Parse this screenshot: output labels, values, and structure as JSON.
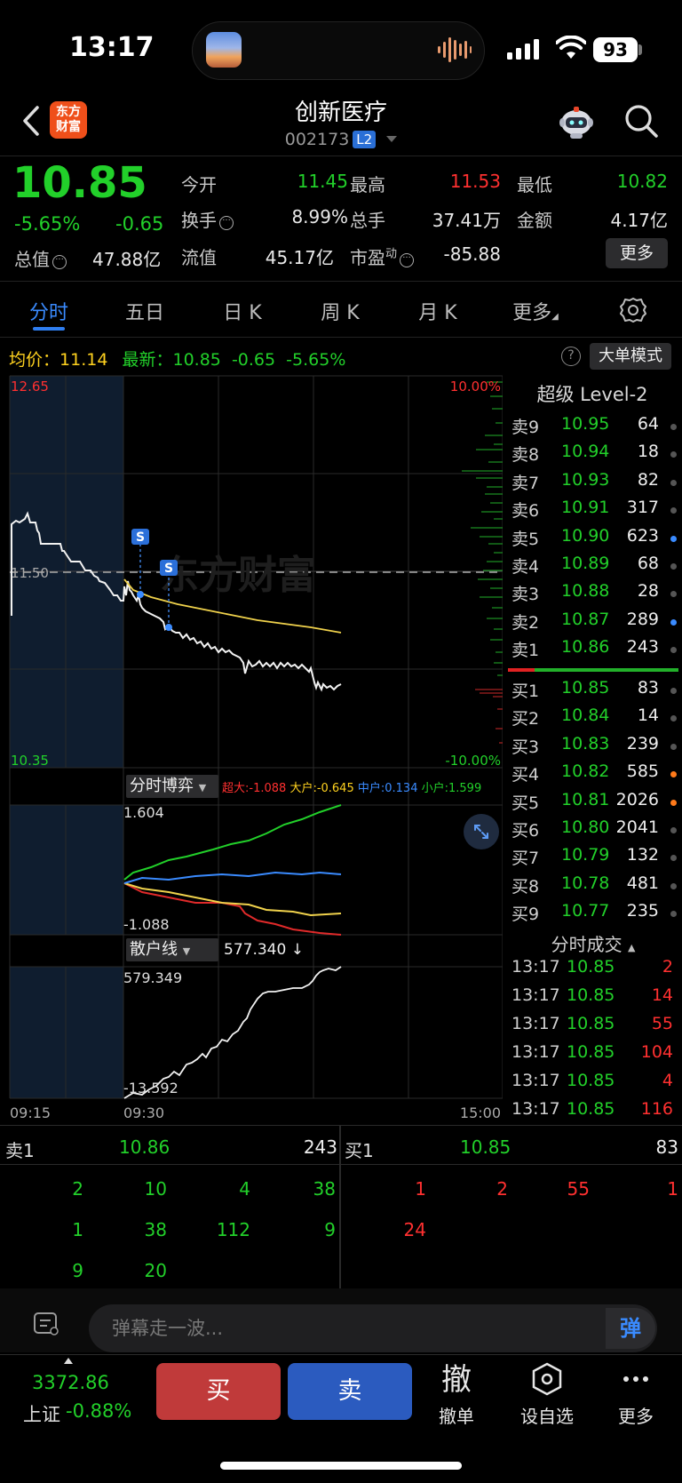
{
  "status": {
    "time": "13:17",
    "battery": "93"
  },
  "header": {
    "logo_line1": "东方",
    "logo_line2": "财富",
    "stock_name": "创新医疗",
    "stock_code": "002173",
    "badge": "L2"
  },
  "quote": {
    "price": "10.85",
    "pct": "-5.65%",
    "change": "-0.65",
    "total_label": "总值",
    "total_value": "47.88亿",
    "stats": [
      {
        "label": "今开",
        "value": "11.45",
        "color": "#22d02a"
      },
      {
        "label": "最高",
        "value": "11.53",
        "color": "#ff3030"
      },
      {
        "label": "最低",
        "value": "10.82",
        "color": "#22d02a"
      },
      {
        "label": "换手",
        "value": "8.99%",
        "color": "#e8e8e8"
      },
      {
        "label": "总手",
        "value": "37.41万",
        "color": "#e8e8e8"
      },
      {
        "label": "金额",
        "value": "4.17亿",
        "color": "#e8e8e8"
      },
      {
        "label": "流值",
        "value": "45.17亿",
        "color": "#e8e8e8"
      },
      {
        "label": "市盈",
        "sup": "动",
        "value": "-85.88",
        "color": "#e8e8e8"
      }
    ],
    "more": "更多"
  },
  "tabs": [
    "分时",
    "五日",
    "日 K",
    "周 K",
    "月 K",
    "更多"
  ],
  "summary": {
    "avg_label": "均价：",
    "avg_value": "11.14",
    "latest_label": "最新：",
    "latest_value": "10.85",
    "latest_change": "-0.65",
    "latest_pct": "-5.65%",
    "help": "?",
    "big_mode": "大单模式"
  },
  "main_chart": {
    "y_top": "12.65",
    "y_bottom": "10.35",
    "y_ref": "11.50",
    "pct_top": "10.00%",
    "pct_bottom": "-10.00%",
    "watermark": "东方财富",
    "marker": "S",
    "times": [
      "09:15",
      "09:30",
      "15:00"
    ]
  },
  "sub1": {
    "label": "分时博弈",
    "top": "1.604",
    "bottom": "-1.088",
    "values": [
      {
        "text": "超大:-1.088",
        "color": "#ff3030"
      },
      {
        "text": "大户:-0.645",
        "color": "#ffd21f"
      },
      {
        "text": "中户:0.134",
        "color": "#3a8bff"
      },
      {
        "text": "小户:1.599",
        "color": "#22d02a"
      }
    ]
  },
  "sub2": {
    "label": "散户线",
    "value": "577.340 ↓",
    "top": "579.349",
    "bottom": "-13.592"
  },
  "orderbook": {
    "title": "超级 Level-2",
    "asks": [
      {
        "label": "卖9",
        "price": "10.95",
        "vol": "64",
        "dot": "#555"
      },
      {
        "label": "卖8",
        "price": "10.94",
        "vol": "18",
        "dot": "#555"
      },
      {
        "label": "卖7",
        "price": "10.93",
        "vol": "82",
        "dot": "#555"
      },
      {
        "label": "卖6",
        "price": "10.91",
        "vol": "317",
        "dot": "#555"
      },
      {
        "label": "卖5",
        "price": "10.90",
        "vol": "623",
        "dot": "#3a8bff"
      },
      {
        "label": "卖4",
        "price": "10.89",
        "vol": "68",
        "dot": "#555"
      },
      {
        "label": "卖3",
        "price": "10.88",
        "vol": "28",
        "dot": "#555"
      },
      {
        "label": "卖2",
        "price": "10.87",
        "vol": "289",
        "dot": "#3a8bff"
      },
      {
        "label": "卖1",
        "price": "10.86",
        "vol": "243",
        "dot": "#555"
      }
    ],
    "bids": [
      {
        "label": "买1",
        "price": "10.85",
        "vol": "83",
        "dot": "#555"
      },
      {
        "label": "买2",
        "price": "10.84",
        "vol": "14",
        "dot": "#555"
      },
      {
        "label": "买3",
        "price": "10.83",
        "vol": "239",
        "dot": "#555"
      },
      {
        "label": "买4",
        "price": "10.82",
        "vol": "585",
        "dot": "#ff7a1a"
      },
      {
        "label": "买5",
        "price": "10.81",
        "vol": "2026",
        "dot": "#ff7a1a"
      },
      {
        "label": "买6",
        "price": "10.80",
        "vol": "2041",
        "dot": "#555"
      },
      {
        "label": "买7",
        "price": "10.79",
        "vol": "132",
        "dot": "#555"
      },
      {
        "label": "买8",
        "price": "10.78",
        "vol": "481",
        "dot": "#555"
      },
      {
        "label": "买9",
        "price": "10.77",
        "vol": "235",
        "dot": "#555"
      }
    ]
  },
  "trades": {
    "title": "分时成交",
    "rows": [
      {
        "time": "13:17",
        "price": "10.85",
        "vol": "2"
      },
      {
        "time": "13:17",
        "price": "10.85",
        "vol": "14"
      },
      {
        "time": "13:17",
        "price": "10.85",
        "vol": "55"
      },
      {
        "time": "13:17",
        "price": "10.85",
        "vol": "104"
      },
      {
        "time": "13:17",
        "price": "10.85",
        "vol": "4"
      },
      {
        "time": "13:17",
        "price": "10.85",
        "vol": "116"
      }
    ]
  },
  "queue": {
    "sell": {
      "label": "卖1",
      "price": "10.86",
      "vol": "243",
      "orders": [
        [
          "2",
          "10",
          "4",
          "38"
        ],
        [
          "1",
          "38",
          "112",
          "9"
        ],
        [
          "9",
          "20",
          "",
          ""
        ]
      ]
    },
    "buy": {
      "label": "买1",
      "price": "10.85",
      "vol": "83",
      "orders": [
        [
          "1",
          "2",
          "55",
          "1"
        ],
        [
          "24",
          "",
          "",
          ""
        ]
      ]
    }
  },
  "comment": {
    "placeholder": "弹幕走一波...",
    "danmu": "弹"
  },
  "bottom": {
    "index_value": "3372.86",
    "index_name": "上证",
    "index_pct": "-0.88%",
    "buy": "买",
    "sell": "卖",
    "cancel_icon": "撤",
    "cancel": "撤单",
    "watch": "设自选",
    "more": "更多"
  }
}
